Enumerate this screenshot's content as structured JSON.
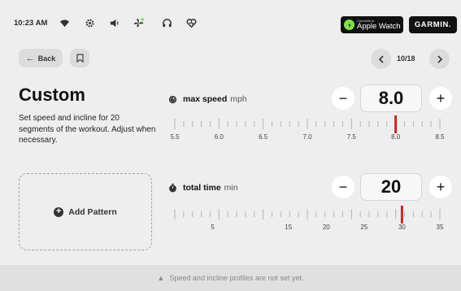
{
  "status_bar": {
    "time": "10:23 AM",
    "icons": [
      "wifi-icon",
      "gear-icon",
      "volume-icon",
      "fan-icon",
      "headphones-icon",
      "heart-icon"
    ],
    "apple_watch": {
      "small": "Connects to",
      "big": "Apple Watch"
    },
    "garmin": "GARMIN."
  },
  "nav": {
    "back_label": "Back",
    "pager": "10/18"
  },
  "workout": {
    "title": "Custom",
    "description": "Set speed and incline for 20 segments of the workout. Adjust when necessary.",
    "add_pattern": "Add Pattern"
  },
  "max_speed": {
    "label": "max speed",
    "unit": "mph",
    "value": "8.0",
    "scale_labels": [
      "5.5",
      "6.0",
      "6.5",
      "7.0",
      "7.5",
      "8.0",
      "8.5"
    ],
    "scale_min": 5.5,
    "scale_max": 8.5,
    "current": 8.0
  },
  "total_time": {
    "label": "total time",
    "unit": "min",
    "value": "20",
    "scale_labels": [
      "5",
      "15",
      "20",
      "25",
      "30",
      "35"
    ],
    "scale_min": 0,
    "scale_max": 35,
    "current": 30
  },
  "footer": {
    "message": "Speed and incline profiles are not set yet."
  },
  "colors": {
    "background": "#eeeeee",
    "accent_red": "#c62828",
    "apple_green": "#7ee14b"
  }
}
